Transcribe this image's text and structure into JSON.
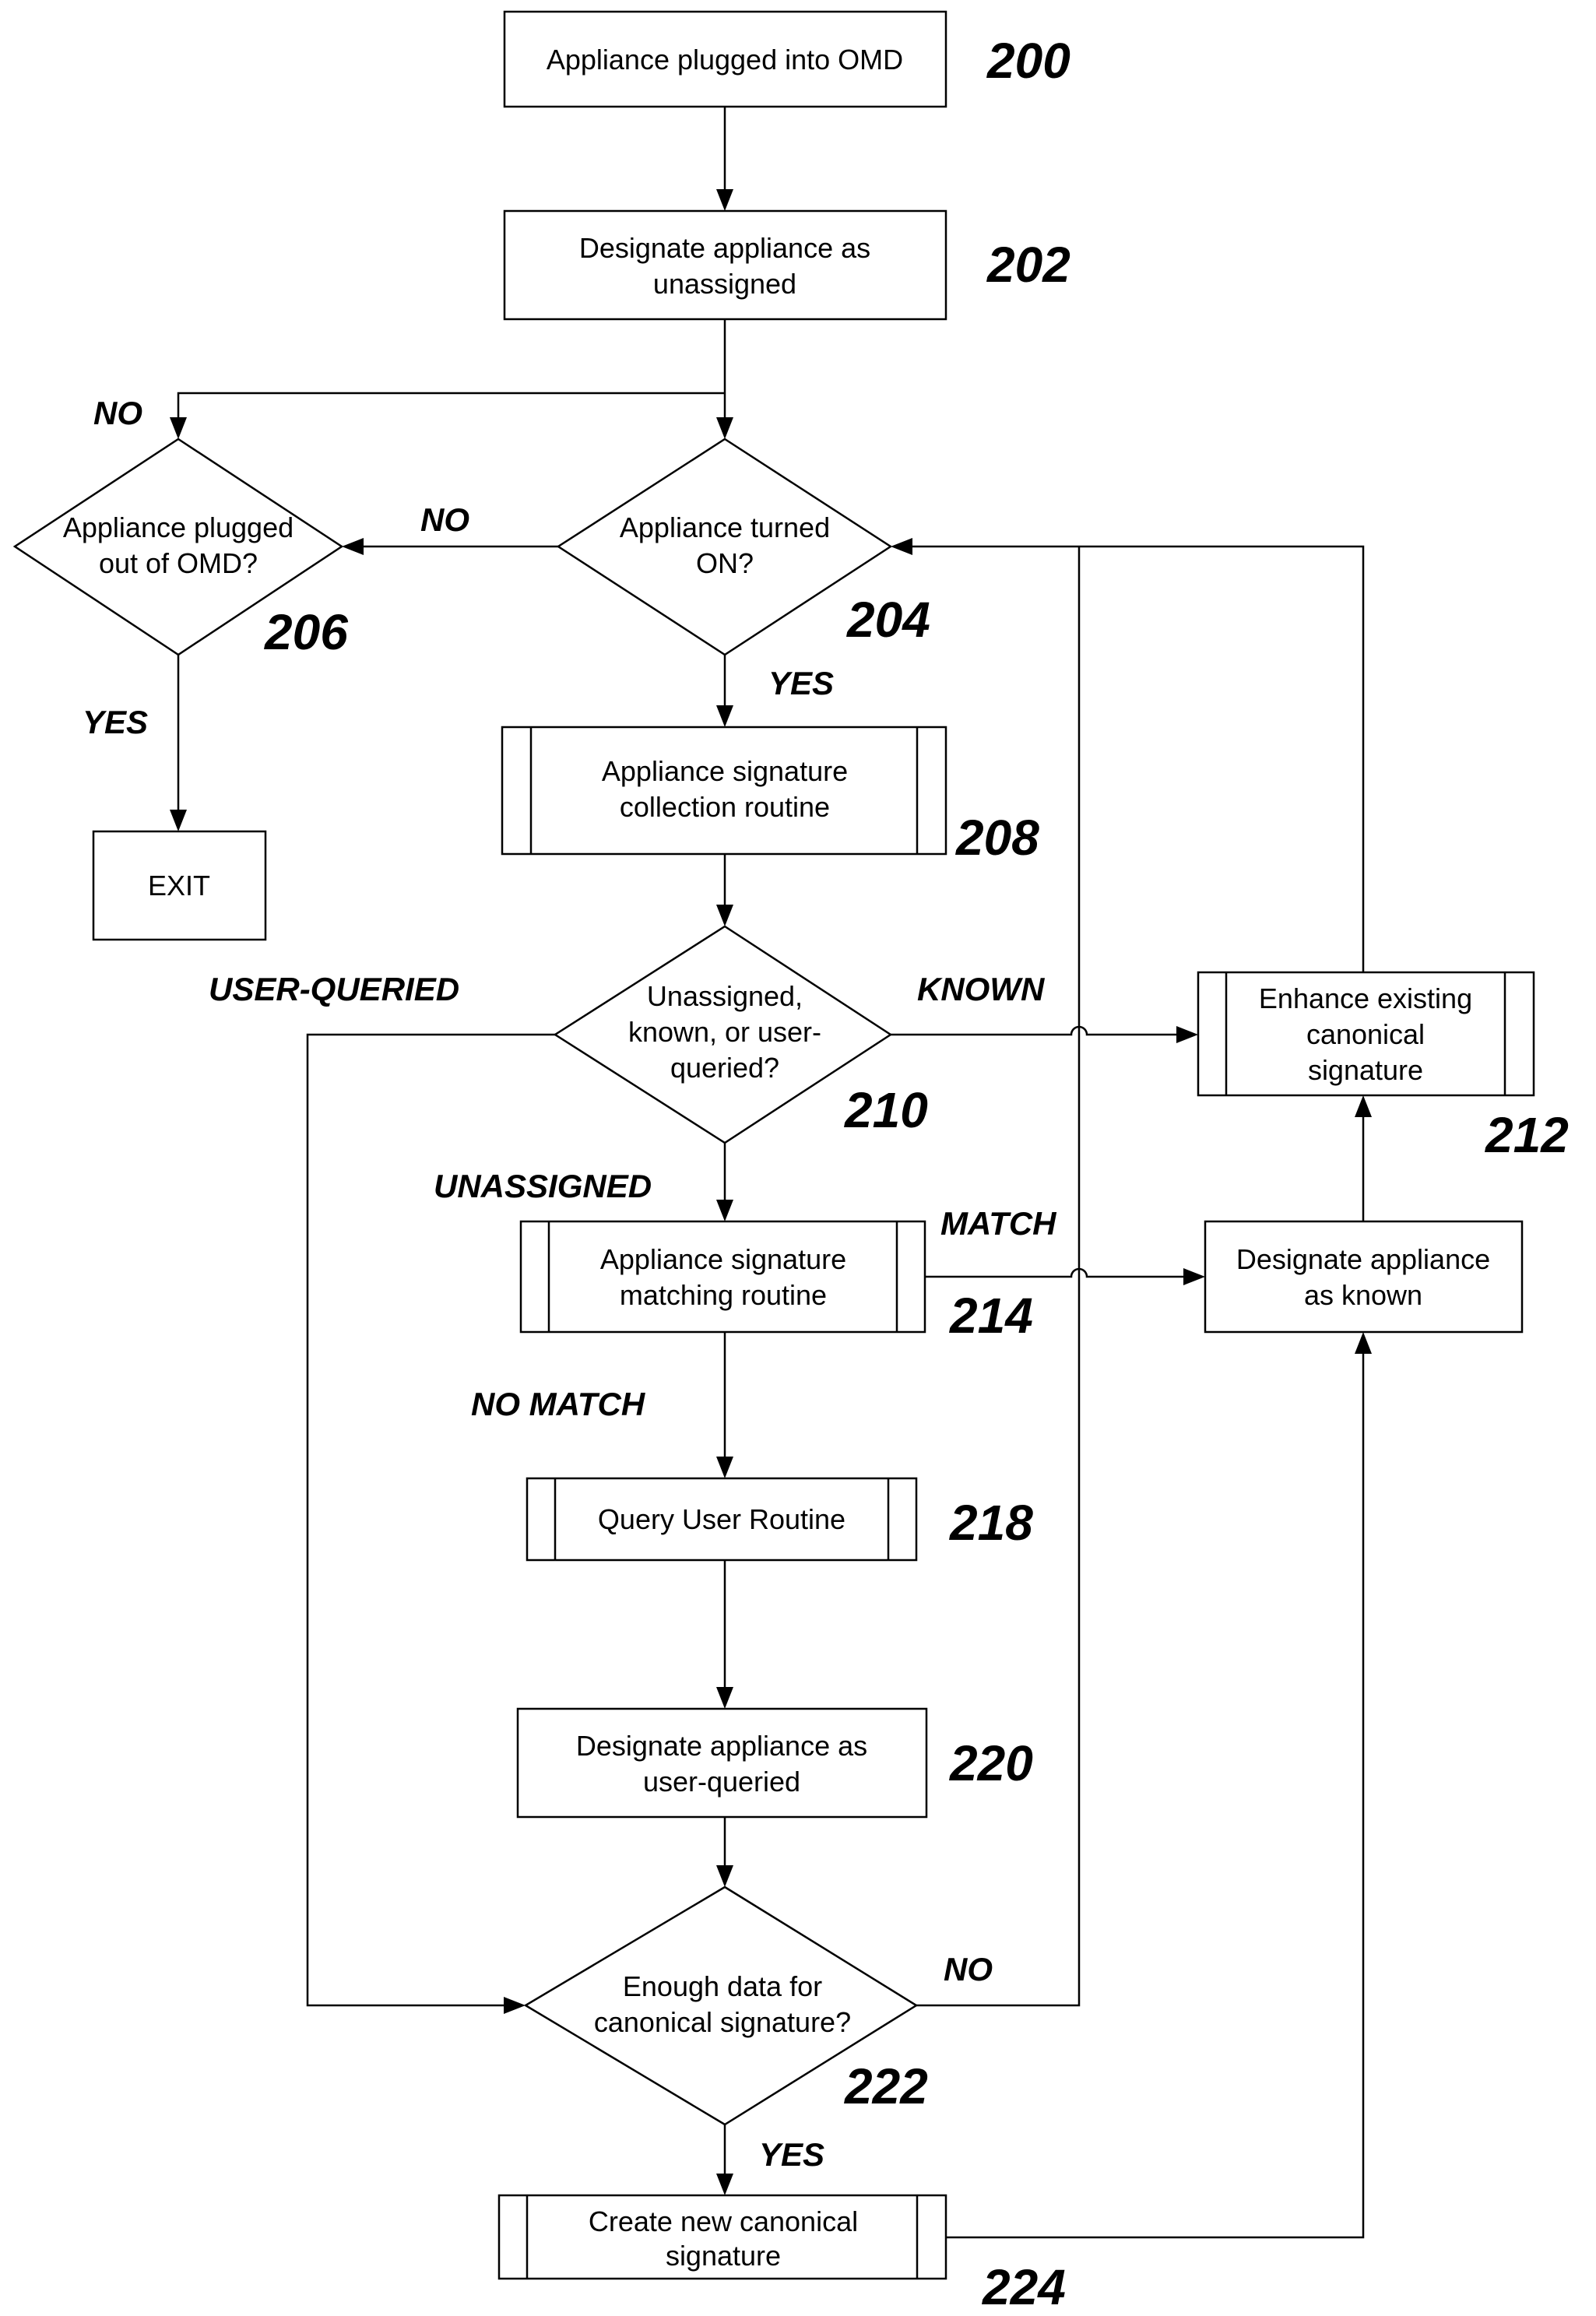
{
  "diagram": {
    "type": "flowchart",
    "nodes": [
      {
        "id": "200",
        "kind": "process",
        "ref": "200",
        "lines": [
          "Appliance plugged into OMD"
        ]
      },
      {
        "id": "202",
        "kind": "process",
        "ref": "202",
        "lines": [
          "Designate appliance as",
          "unassigned"
        ]
      },
      {
        "id": "204",
        "kind": "decision",
        "ref": "204",
        "lines": [
          "Appliance turned",
          "ON?"
        ]
      },
      {
        "id": "206",
        "kind": "decision",
        "ref": "206",
        "lines": [
          "Appliance plugged",
          "out of OMD?"
        ]
      },
      {
        "id": "exit",
        "kind": "process",
        "ref": "",
        "lines": [
          "EXIT"
        ]
      },
      {
        "id": "208",
        "kind": "subroutine",
        "ref": "208",
        "lines": [
          "Appliance signature",
          "collection routine"
        ]
      },
      {
        "id": "210",
        "kind": "decision",
        "ref": "210",
        "lines": [
          "Unassigned,",
          "known, or user-",
          "queried?"
        ]
      },
      {
        "id": "212",
        "kind": "subroutine",
        "ref": "212",
        "lines": [
          "Enhance existing",
          "canonical",
          "signature"
        ]
      },
      {
        "id": "214",
        "kind": "subroutine",
        "ref": "214",
        "lines": [
          "Appliance signature",
          "matching routine"
        ]
      },
      {
        "id": "216",
        "kind": "process",
        "ref": "",
        "lines": [
          "Designate appliance",
          "as known"
        ]
      },
      {
        "id": "218",
        "kind": "subroutine",
        "ref": "218",
        "lines": [
          "Query User Routine"
        ]
      },
      {
        "id": "220",
        "kind": "process",
        "ref": "220",
        "lines": [
          "Designate appliance as",
          "user-queried"
        ]
      },
      {
        "id": "222",
        "kind": "decision",
        "ref": "222",
        "lines": [
          "Enough data for",
          "canonical signature?"
        ]
      },
      {
        "id": "224",
        "kind": "subroutine",
        "ref": "224",
        "lines": [
          "Create new canonical",
          "signature"
        ]
      }
    ],
    "edge_labels": {
      "no_206_entry": "NO",
      "no_204": "NO",
      "yes_204": "YES",
      "yes_206": "YES",
      "user_queried": "USER-QUERIED",
      "known": "KNOWN",
      "unassigned": "UNASSIGNED",
      "match": "MATCH",
      "no_match": "NO MATCH",
      "no_222": "NO",
      "yes_222": "YES"
    },
    "edges": [
      {
        "from": "200",
        "to": "202"
      },
      {
        "from": "202",
        "to": "204"
      },
      {
        "from": "202",
        "to": "206",
        "label": "NO"
      },
      {
        "from": "204",
        "to": "206",
        "label": "NO"
      },
      {
        "from": "206",
        "to": "exit",
        "label": "YES"
      },
      {
        "from": "204",
        "to": "208",
        "label": "YES"
      },
      {
        "from": "208",
        "to": "210"
      },
      {
        "from": "210",
        "to": "212",
        "label": "KNOWN"
      },
      {
        "from": "210",
        "to": "214",
        "label": "UNASSIGNED"
      },
      {
        "from": "210",
        "to": "222",
        "label": "USER-QUERIED"
      },
      {
        "from": "214",
        "to": "216",
        "label": "MATCH"
      },
      {
        "from": "214",
        "to": "218",
        "label": "NO MATCH"
      },
      {
        "from": "216",
        "to": "212"
      },
      {
        "from": "212",
        "to": "204"
      },
      {
        "from": "218",
        "to": "220"
      },
      {
        "from": "220",
        "to": "222"
      },
      {
        "from": "222",
        "to": "204",
        "label": "NO"
      },
      {
        "from": "222",
        "to": "224",
        "label": "YES"
      },
      {
        "from": "224",
        "to": "216"
      }
    ]
  }
}
